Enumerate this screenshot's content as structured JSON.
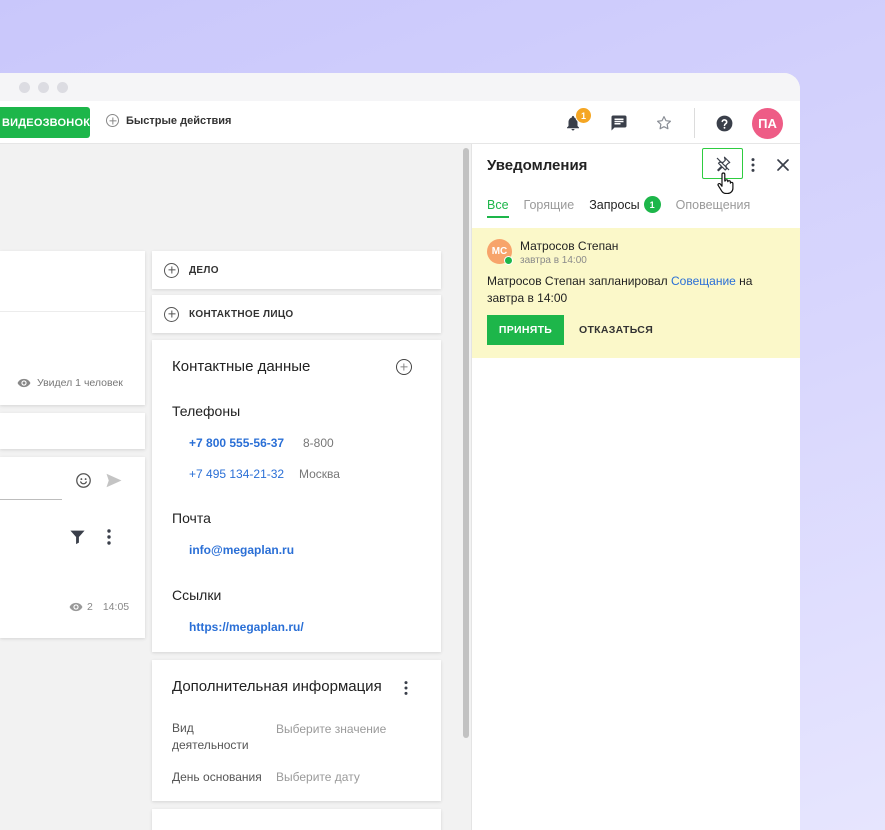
{
  "topbar": {
    "video_button": "ВИДЕОЗВОНОК",
    "quick_actions": "Быстрые действия",
    "bell_badge": "1",
    "avatar_initials": "ПА"
  },
  "actions": {
    "deal": "ДЕЛО",
    "contact": "КОНТАКТНОЕ ЛИЦО"
  },
  "left": {
    "seen_by": "Увидел 1 человек",
    "comment_views": "2",
    "comment_time": "14:05"
  },
  "contacts": {
    "title": "Контактные данные",
    "phones_label": "Телефоны",
    "phones": [
      {
        "number": "+7 800 555-56-37",
        "note": "8-800"
      },
      {
        "number": "+7 495 134-21-32",
        "note": "Москва"
      }
    ],
    "mail_label": "Почта",
    "email": "info@megaplan.ru",
    "links_label": "Ссылки",
    "link": "https://megaplan.ru/"
  },
  "additional": {
    "title": "Дополнительная информация",
    "activity_label": "Вид деятельности",
    "activity_placeholder": "Выберите значение",
    "founded_label": "День основания",
    "founded_placeholder": "Выберите дату"
  },
  "notifications": {
    "title": "Уведомления",
    "tabs": [
      {
        "label": "Все"
      },
      {
        "label": "Горящие"
      },
      {
        "label": "Запросы",
        "badge": "1"
      },
      {
        "label": "Оповещения"
      }
    ],
    "item": {
      "avatar": "МС",
      "name": "Матросов Степан",
      "time": "завтра в 14:00",
      "text_before": "Матросов Степан запланировал ",
      "text_link": "Совещание",
      "text_after": " на завтра в 14:00",
      "accept": "ПРИНЯТЬ",
      "decline": "ОТКАЗАТЬСЯ"
    }
  },
  "colors": {
    "accent_green": "#1db64a",
    "link_blue": "#2a6fd6",
    "notif_bg": "#fbf8c9",
    "badge_orange": "#f5a623",
    "avatar_pink": "#ee5c86"
  }
}
